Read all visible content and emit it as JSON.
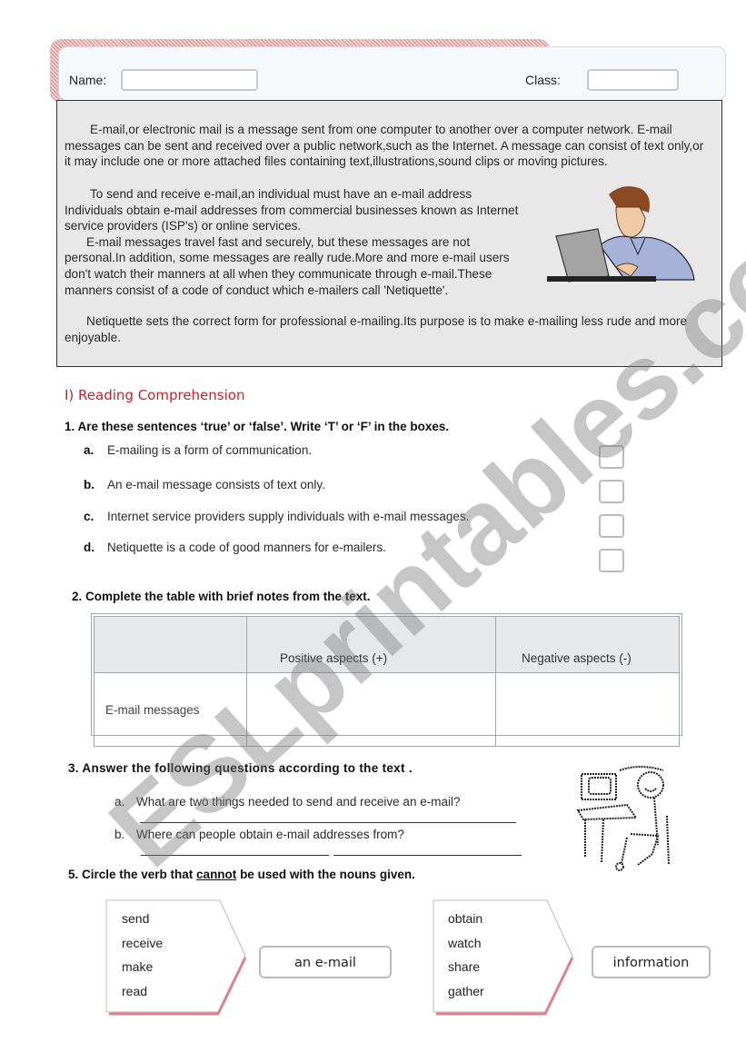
{
  "header": {
    "name_label": "Name:",
    "class_label": "Class:",
    "name_value": "",
    "class_value": ""
  },
  "passage": {
    "paragraphs": [
      "E-mail,or electronic mail is a message sent from one computer to another over a computer network. E-mail messages can be sent and received over a public network,such as the Internet. A message can consist of text only,or it may include one or more attached files containing text,illustrations,sound clips or moving pictures.",
      "To send and receive e-mail,an individual must have an e-mail address Individuals obtain e-mail addresses from commercial businesses known as Internet service providers (ISP's) or online services.",
      "E-mail messages travel fast and securely, but these messages are not personal.In addition, some messages are really rude.More and more e-mail users don't watch their manners at all when they communicate through e-mail.These manners consist of a code of conduct which e-mailers call 'Netiquette'.",
      "Netiquette sets the correct form for professional e-mailing.Its purpose is to make e-mailing less rude and more enjoyable."
    ],
    "image_icon": "man-at-laptop-clipart"
  },
  "section": {
    "title": "I) Reading Comprehension"
  },
  "q1": {
    "title": "1. Are these sentences ‘true’ or ‘false’. Write ‘T’ or  ‘F’ in the boxes.",
    "items": [
      {
        "letter": "a.",
        "text": "E-mailing is a  form of communication.",
        "answer": ""
      },
      {
        "letter": "b.",
        "text": "An e-mail message consists of text only.",
        "answer": ""
      },
      {
        "letter": "c.",
        "text": "Internet service providers supply individuals with e-mail messages.",
        "answer": ""
      },
      {
        "letter": "d.",
        "text": "Netiquette is a code of good manners for e-mailers.",
        "answer": ""
      }
    ]
  },
  "q2": {
    "title": "2.  Complete the table with brief notes from the text.",
    "headers": [
      "",
      "Positive aspects (+)",
      "Negative aspects (-)"
    ],
    "rows": [
      [
        "E-mail messages",
        "",
        ""
      ]
    ]
  },
  "q3": {
    "title": "3.   Answer the following questions according to the text .",
    "questions": [
      {
        "letter": "a.",
        "text": "What are two things needed to send and receive an e-mail?"
      },
      {
        "letter": "b.",
        "text": "Where can people obtain e-mail addresses from?"
      }
    ],
    "image_icon": "stick-figure-at-computer-clipart"
  },
  "q5": {
    "title_pre": "5.   Circle the verb that ",
    "title_emph": "cannot",
    "title_post": " be used with the nouns given.",
    "groups": [
      {
        "verbs": [
          "send",
          "receive",
          "make",
          "read"
        ],
        "noun": "an e-mail"
      },
      {
        "verbs": [
          "obtain",
          "watch",
          "share",
          "gather"
        ],
        "noun": "information"
      }
    ]
  },
  "watermark": "ESLprintables.com",
  "colors": {
    "accent_red": "#c8202a",
    "passage_bg": "#e8e8e8",
    "table_header_bg": "#e6e8ea",
    "arrow_shadow": "#e08088"
  }
}
